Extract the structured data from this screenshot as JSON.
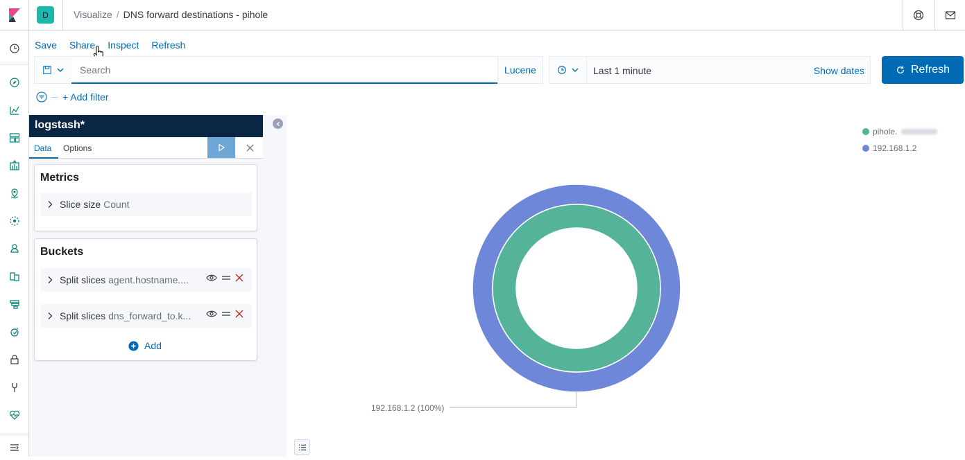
{
  "header": {
    "space_initial": "D",
    "breadcrumb_parent": "Visualize",
    "breadcrumb_separator": "/",
    "breadcrumb_current": "DNS forward destinations - pihole"
  },
  "topnav": {
    "save": "Save",
    "share": "Share",
    "inspect": "Inspect",
    "refresh": "Refresh"
  },
  "query": {
    "placeholder": "Search",
    "language": "Lucene",
    "time_range": "Last 1 minute",
    "show_dates": "Show dates",
    "refresh_label": "Refresh"
  },
  "filters": {
    "add_filter": "+ Add filter"
  },
  "editor": {
    "index_pattern": "logstash*",
    "tabs": {
      "data": "Data",
      "options": "Options"
    },
    "metrics": {
      "title": "Metrics",
      "items": [
        {
          "label": "Slice size",
          "value": "Count"
        }
      ]
    },
    "buckets": {
      "title": "Buckets",
      "items": [
        {
          "label": "Split slices",
          "value": "agent.hostname...."
        },
        {
          "label": "Split slices",
          "value": "dns_forward_to.k..."
        }
      ],
      "add_label": "Add"
    }
  },
  "chart_data": {
    "type": "pie",
    "donut": true,
    "rings": [
      {
        "level": "outer",
        "slices": [
          {
            "label": "192.168.1.2",
            "percent": 100,
            "color": "#6f87d8"
          }
        ]
      },
      {
        "level": "inner",
        "slices": [
          {
            "label": "pihole.",
            "percent": 100,
            "color": "#54b399"
          }
        ]
      }
    ],
    "legend": [
      {
        "label": "pihole.",
        "color": "#54b399"
      },
      {
        "label": "192.168.1.2",
        "color": "#6f87d8"
      }
    ],
    "legend_position": "top-right",
    "slice_label": "192.168.1.2 (100%)"
  },
  "colors": {
    "primary": "#006bb4",
    "nav_dark": "#0b2545",
    "badge": "#1bb9ad"
  }
}
